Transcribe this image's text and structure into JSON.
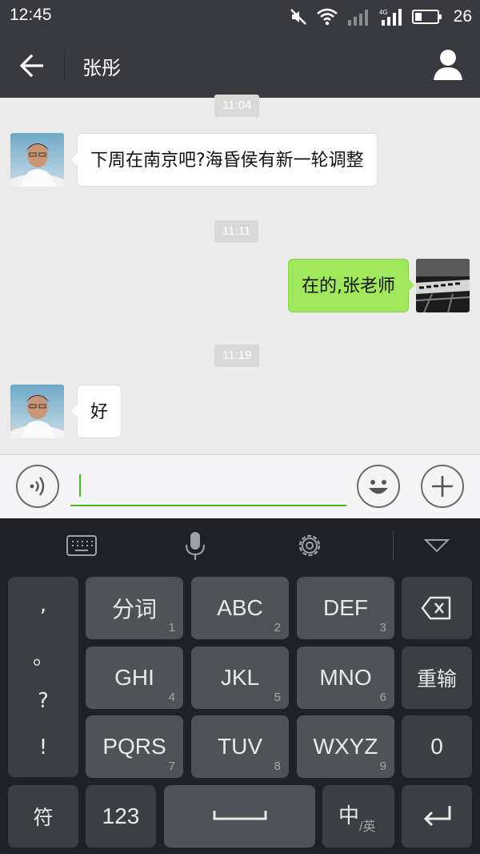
{
  "status_bar": {
    "time": "12:45",
    "icons": [
      "mute-icon",
      "wifi-icon",
      "signal-icon",
      "4g-signal-icon",
      "battery-icon"
    ],
    "battery_level": "26"
  },
  "header": {
    "title": "张彤",
    "back_icon": "arrow-left-icon",
    "profile_icon": "person-icon"
  },
  "chat": {
    "messages": [
      {
        "timestamp": "11:04"
      },
      {
        "side": "left",
        "text": "下周在南京吧?海昏侯有新一轮调整"
      },
      {
        "timestamp": "11:11"
      },
      {
        "side": "right",
        "text": "在的,张老师"
      },
      {
        "timestamp": "11:19"
      },
      {
        "side": "left",
        "text": "好"
      }
    ]
  },
  "input_bar": {
    "voice_icon": "voice-icon",
    "emoji_icon": "emoji-icon",
    "plus_icon": "plus-icon",
    "text_value": ""
  },
  "keyboard": {
    "toolbar": [
      "keyboard-icon",
      "microphone-icon",
      "gear-icon",
      "collapse-icon"
    ],
    "punctuation": [
      ",",
      "。",
      "?",
      "!"
    ],
    "keys": [
      {
        "label": "分词",
        "num": "1"
      },
      {
        "label": "ABC",
        "num": "2"
      },
      {
        "label": "DEF",
        "num": "3"
      },
      {
        "label": "GHI",
        "num": "4"
      },
      {
        "label": "JKL",
        "num": "5"
      },
      {
        "label": "MNO",
        "num": "6"
      },
      {
        "label": "PQRS",
        "num": "7"
      },
      {
        "label": "TUV",
        "num": "8"
      },
      {
        "label": "WXYZ",
        "num": "9"
      }
    ],
    "reinput": "重输",
    "zero": "0",
    "symbol": "符",
    "numeric": "123",
    "lang_main": "中",
    "lang_sub": "/英"
  },
  "colors": {
    "bar": "#393a3f",
    "bubble_right": "#9fe75b",
    "accent": "#45c01a",
    "keyboard_bg": "#1e2226",
    "key_bg": "#4f5358"
  }
}
